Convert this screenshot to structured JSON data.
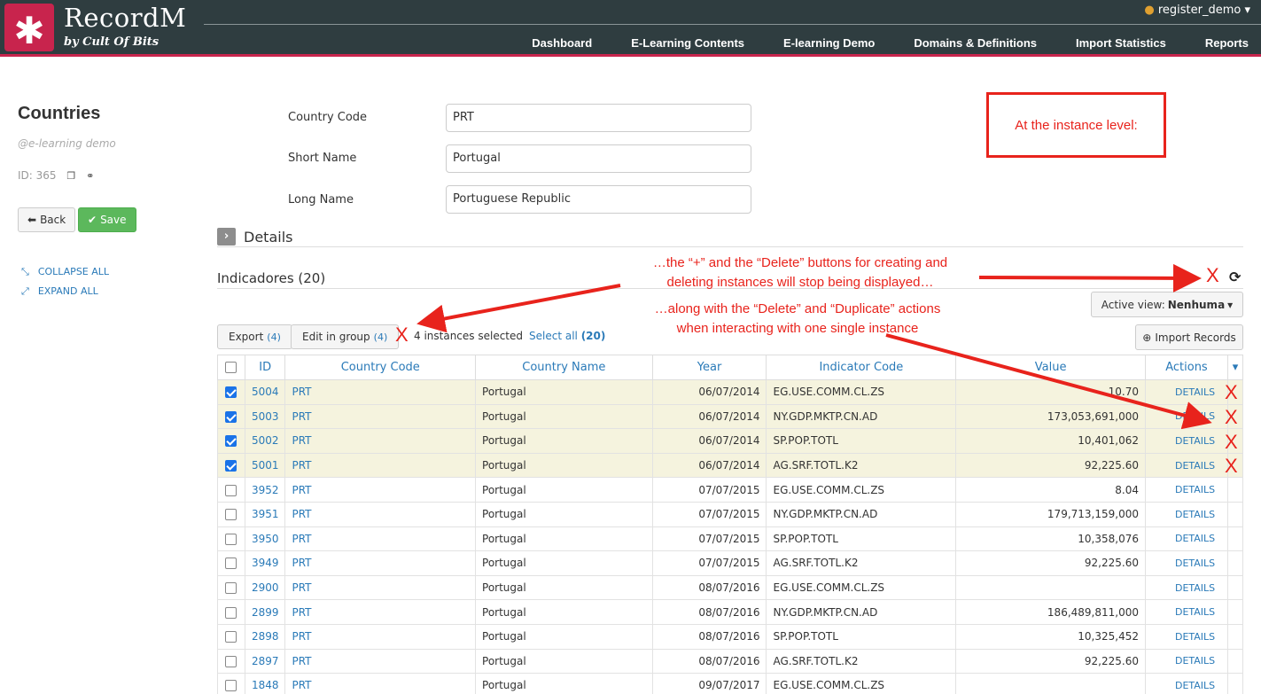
{
  "header": {
    "logo_glyph": "✱",
    "brand": "RecordM",
    "brand_sub": "by Cult Of Bits",
    "user": "register_demo",
    "nav": [
      "Dashboard",
      "E-Learning Contents",
      "E-learning Demo",
      "Domains & Definitions",
      "Import Statistics",
      "Reports"
    ]
  },
  "sidebar": {
    "title": "Countries",
    "subtitle": "@e-learning demo",
    "id_label": "ID: 365",
    "back_label": "Back",
    "save_label": "Save",
    "collapse_label": "COLLAPSE ALL",
    "expand_label": "EXPAND ALL"
  },
  "form": {
    "country_code_label": "Country Code",
    "country_code_value": "PRT",
    "short_name_label": "Short Name",
    "short_name_value": "Portugal",
    "long_name_label": "Long Name",
    "long_name_value": "Portuguese Republic",
    "details_label": "Details"
  },
  "instances": {
    "title": "Indicadores (20)",
    "active_view_label": "Active view:",
    "active_view_value": "Nenhuma",
    "export_label": "Export",
    "export_count": "(4)",
    "edit_group_label": "Edit in group",
    "edit_group_count": "(4)",
    "selected_text": "4 instances selected",
    "select_all_label": "Select all",
    "select_all_count": "(20)",
    "import_label": "Import Records",
    "columns": [
      "ID",
      "Country Code",
      "Country Name",
      "Year",
      "Indicator Code",
      "Value",
      "Actions"
    ],
    "rows": [
      {
        "checked": true,
        "id": "5004",
        "cc": "PRT",
        "name": "Portugal",
        "year": "06/07/2014",
        "indicator": "EG.USE.COMM.CL.ZS",
        "value": "10.70",
        "action": "DETAILS"
      },
      {
        "checked": true,
        "id": "5003",
        "cc": "PRT",
        "name": "Portugal",
        "year": "06/07/2014",
        "indicator": "NY.GDP.MKTP.CN.AD",
        "value": "173,053,691,000",
        "action": "DETAILS"
      },
      {
        "checked": true,
        "id": "5002",
        "cc": "PRT",
        "name": "Portugal",
        "year": "06/07/2014",
        "indicator": "SP.POP.TOTL",
        "value": "10,401,062",
        "action": "DETAILS"
      },
      {
        "checked": true,
        "id": "5001",
        "cc": "PRT",
        "name": "Portugal",
        "year": "06/07/2014",
        "indicator": "AG.SRF.TOTL.K2",
        "value": "92,225.60",
        "action": "DETAILS"
      },
      {
        "checked": false,
        "id": "3952",
        "cc": "PRT",
        "name": "Portugal",
        "year": "07/07/2015",
        "indicator": "EG.USE.COMM.CL.ZS",
        "value": "8.04",
        "action": "DETAILS"
      },
      {
        "checked": false,
        "id": "3951",
        "cc": "PRT",
        "name": "Portugal",
        "year": "07/07/2015",
        "indicator": "NY.GDP.MKTP.CN.AD",
        "value": "179,713,159,000",
        "action": "DETAILS"
      },
      {
        "checked": false,
        "id": "3950",
        "cc": "PRT",
        "name": "Portugal",
        "year": "07/07/2015",
        "indicator": "SP.POP.TOTL",
        "value": "10,358,076",
        "action": "DETAILS"
      },
      {
        "checked": false,
        "id": "3949",
        "cc": "PRT",
        "name": "Portugal",
        "year": "07/07/2015",
        "indicator": "AG.SRF.TOTL.K2",
        "value": "92,225.60",
        "action": "DETAILS"
      },
      {
        "checked": false,
        "id": "2900",
        "cc": "PRT",
        "name": "Portugal",
        "year": "08/07/2016",
        "indicator": "EG.USE.COMM.CL.ZS",
        "value": "",
        "action": "DETAILS"
      },
      {
        "checked": false,
        "id": "2899",
        "cc": "PRT",
        "name": "Portugal",
        "year": "08/07/2016",
        "indicator": "NY.GDP.MKTP.CN.AD",
        "value": "186,489,811,000",
        "action": "DETAILS"
      },
      {
        "checked": false,
        "id": "2898",
        "cc": "PRT",
        "name": "Portugal",
        "year": "08/07/2016",
        "indicator": "SP.POP.TOTL",
        "value": "10,325,452",
        "action": "DETAILS"
      },
      {
        "checked": false,
        "id": "2897",
        "cc": "PRT",
        "name": "Portugal",
        "year": "08/07/2016",
        "indicator": "AG.SRF.TOTL.K2",
        "value": "92,225.60",
        "action": "DETAILS"
      },
      {
        "checked": false,
        "id": "1848",
        "cc": "PRT",
        "name": "Portugal",
        "year": "09/07/2017",
        "indicator": "EG.USE.COMM.CL.ZS",
        "value": "",
        "action": "DETAILS"
      }
    ]
  },
  "annotations": {
    "box_text": "At the instance level:",
    "line1a": "…the “+” and the “Delete” buttons for creating and",
    "line1b": "deleting instances will stop being displayed…",
    "line2a": "…along with the “Delete” and “Duplicate” actions",
    "line2b": "when interacting with one single instance",
    "x_mark": "X",
    "color": "#e8231c"
  }
}
